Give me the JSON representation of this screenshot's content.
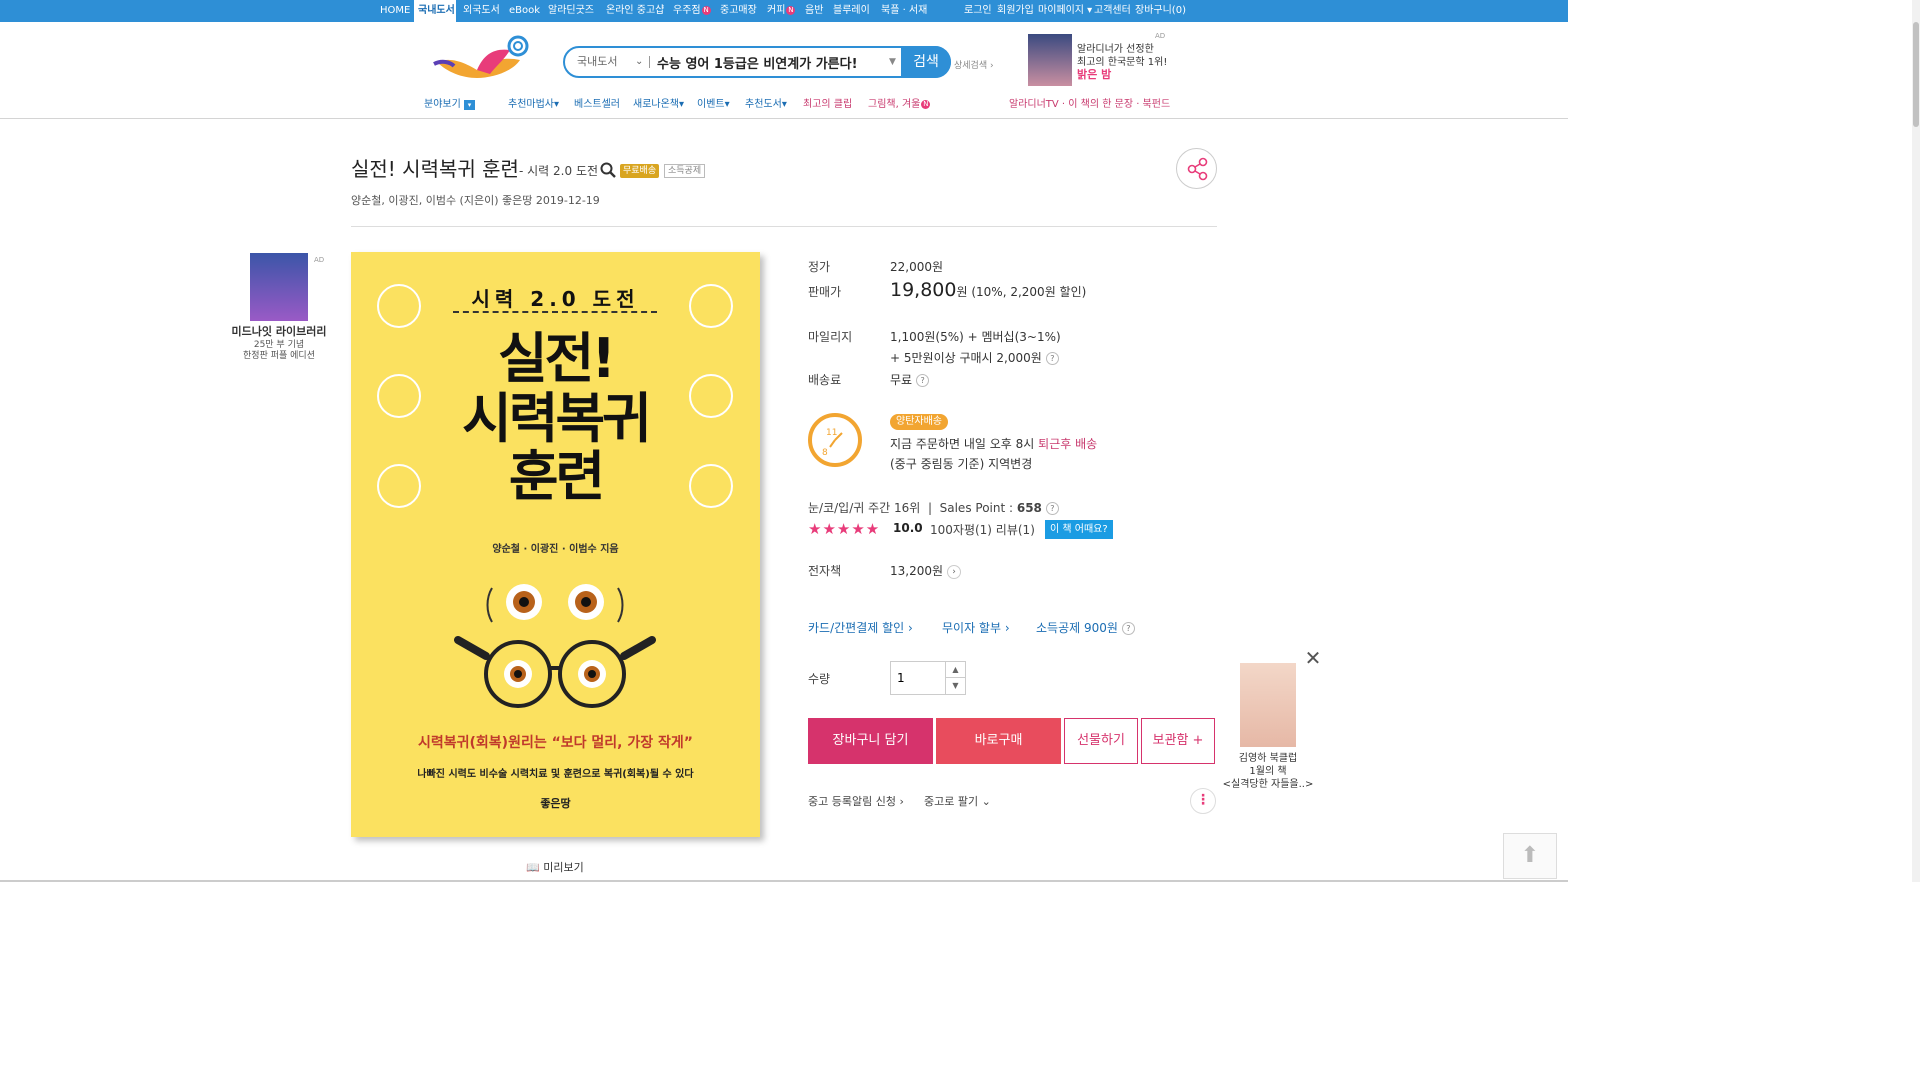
{
  "topnav": {
    "items": [
      {
        "label": "HOME"
      },
      {
        "label": "국내도서",
        "active": true
      },
      {
        "label": "외국도서"
      },
      {
        "label": "eBook"
      },
      {
        "label": "알라딘굿즈"
      },
      {
        "label": "온라인 중고샵"
      },
      {
        "label": "우주점"
      },
      {
        "label": "중고매장"
      },
      {
        "label": "커피"
      },
      {
        "label": "음반"
      },
      {
        "label": "블루레이"
      },
      {
        "label": "북플 · 서재"
      }
    ],
    "right": [
      {
        "label": "로그인"
      },
      {
        "label": "회원가입"
      },
      {
        "label": "마이페이지"
      },
      {
        "label": "고객센터"
      },
      {
        "label": "장바구니(0)"
      }
    ],
    "new_badge": "N"
  },
  "search": {
    "category": "국내도서",
    "query": "수능 영어 1등급은 비연계가 가른다!",
    "button": "검색",
    "advanced": "상세검색"
  },
  "top_ad": {
    "ad": "AD",
    "line1": "알라디너가 선정한",
    "line2": "최고의 한국문학 1위!",
    "line3": "밝은 밤"
  },
  "subnav": {
    "items": [
      {
        "label": "분야보기"
      },
      {
        "label": "추천마법사"
      },
      {
        "label": "베스트셀러"
      },
      {
        "label": "새로나온책"
      },
      {
        "label": "이벤트"
      },
      {
        "label": "추천도서"
      },
      {
        "label": "최고의 클립"
      },
      {
        "label": "그림책, 겨울"
      }
    ],
    "right": "알라디너TV · 이 책의 한 문장 · 북펀드"
  },
  "book": {
    "title": "실전! 시력복귀 훈련",
    "subtitle": "- 시력 2.0 도전",
    "badge_free": "무료배송",
    "badge_tax": "소득공제",
    "authors": "양순철,   이광진,   이범수 (지은이)   좋은땅   2019-12-19"
  },
  "left_ad": {
    "ad": "AD",
    "title": "미드나잇 라이브러리",
    "line1": "25만 부 기념",
    "line2": "한정판 퍼플 에디션"
  },
  "cover": {
    "top": "시력 2.0 도전",
    "title1": "실전!",
    "title2": "시력복귀",
    "title3": "훈련",
    "authors": "양순철 · 이광진 · 이범수 지음",
    "tagline": "시력복귀(회복)원리는 “보다 멀리, 가장 작게”",
    "desc": "나빠진 시력도 비수술 시력치료 및 훈련으로 복귀(회복)될 수 있다",
    "publisher": "좋은땅"
  },
  "preview_label": "미리보기",
  "info": {
    "list_price_label": "정가",
    "list_price": "22,000원",
    "sale_price_label": "판매가",
    "sale_price": "19,800",
    "sale_unit": "원",
    "sale_detail": "(10%, 2,200원 할인)",
    "mileage_label": "마일리지",
    "mileage_line1": "1,100원(5%) + 멤버십(3~1%)",
    "mileage_line2": "+ 5만원이상 구매시 2,000원",
    "shipping_label": "배송료",
    "shipping": "무료",
    "delivery_badge": "양탄자배송",
    "delivery_line1_a": "지금 주문하면 내일 오후 8시 ",
    "delivery_line1_b": "퇴근후 배송",
    "delivery_line2": "(중구 중림동 기준) 지역변경",
    "rank": "눈/코/입/귀 주간 16위",
    "sales_point_label": "Sales Point : ",
    "sales_point": "658",
    "rating": "10.0",
    "stars_value": 5,
    "stars_max": 5,
    "reviews": "100자평(1)   리뷰(1)",
    "how_button": "이 책 어때요?",
    "ebook_label": "전자책",
    "ebook_price": "13,200원",
    "card_discount": "카드/간편결제 할인",
    "installment": "무이자 할부",
    "tax_deduction": "소득공제 900원",
    "qty_label": "수량",
    "qty": "1"
  },
  "buttons": {
    "cart": "장바구니 담기",
    "buy": "바로구매",
    "gift": "선물하기",
    "keep": "보관함 +"
  },
  "used": {
    "alert": "중고 등록알림 신청",
    "sell": "중고로 팔기"
  },
  "right_ad": {
    "line1": "김영하 북클럽",
    "line2": "1월의 책",
    "line3": "<실격당한 자들을..>"
  },
  "colors": {
    "brand_blue": "#2e8fd6",
    "pink": "#d6336c",
    "red": "#e84c5d",
    "cover_yellow": "#fbe160"
  }
}
